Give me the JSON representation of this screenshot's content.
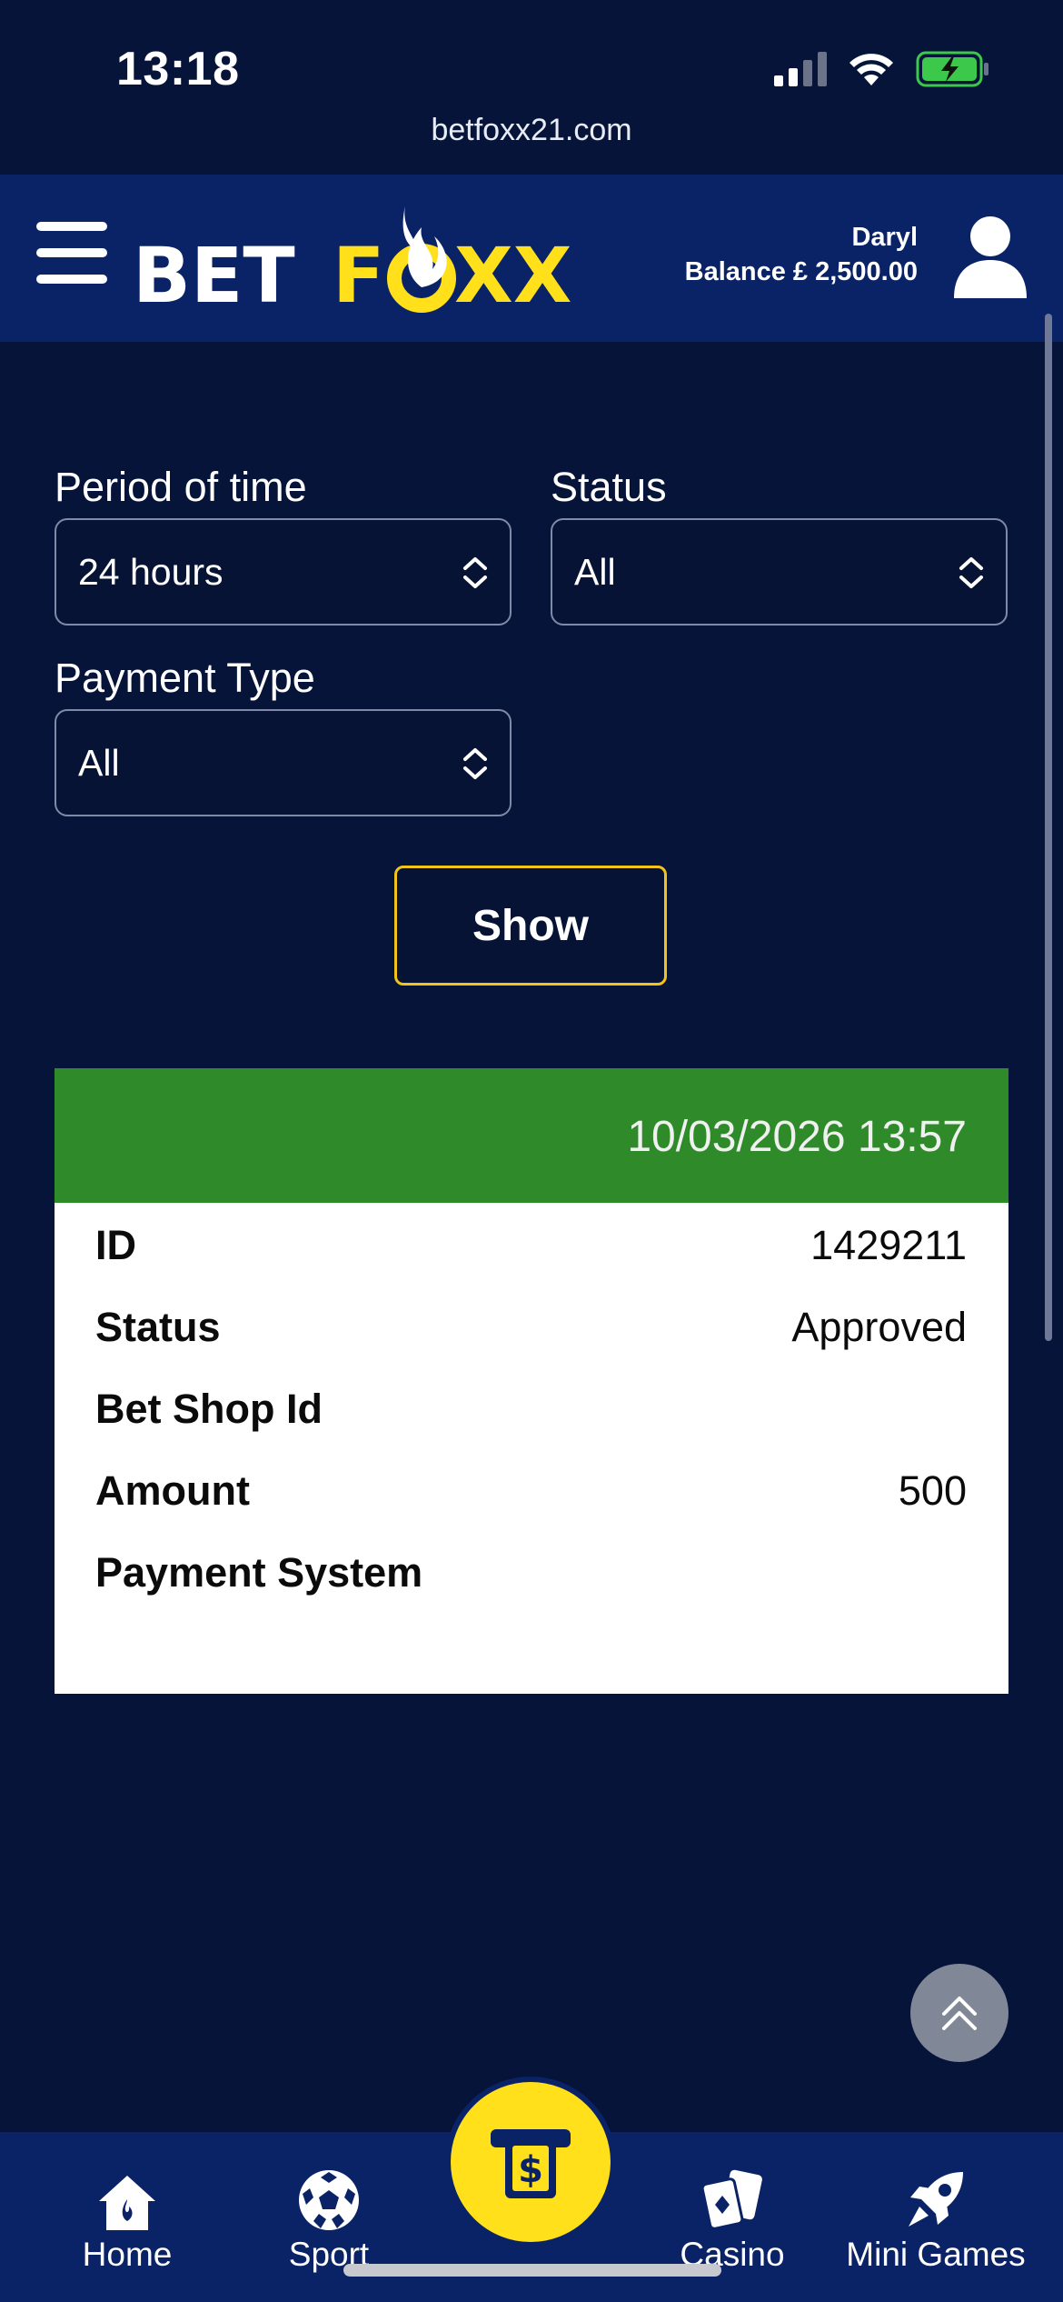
{
  "status_bar": {
    "time": "13:18"
  },
  "browser": {
    "url": "betfoxx21.com"
  },
  "header": {
    "logo_text_a": "BET",
    "logo_text_b": "F",
    "logo_text_c": "XX",
    "user_name": "Daryl",
    "balance": "Balance £ 2,500.00"
  },
  "filters": {
    "period_label": "Period of time",
    "period_value": "24 hours",
    "status_label": "Status",
    "status_value": "All",
    "payment_type_label": "Payment Type",
    "payment_type_value": "All",
    "show_label": "Show"
  },
  "transaction": {
    "datetime": "10/03/2026 13:57",
    "rows": [
      {
        "key": "ID",
        "value": "1429211"
      },
      {
        "key": "Status",
        "value": "Approved"
      },
      {
        "key": "Bet Shop Id",
        "value": ""
      },
      {
        "key": "Amount",
        "value": "500"
      },
      {
        "key": "Payment System",
        "value": ""
      }
    ]
  },
  "bottom_nav": {
    "items": [
      {
        "label": "Home",
        "icon": "home-icon"
      },
      {
        "label": "Sport",
        "icon": "soccer-ball-icon"
      },
      {
        "label": "Casino",
        "icon": "playing-cards-icon"
      },
      {
        "label": "Mini Games",
        "icon": "rocket-icon"
      }
    ],
    "center_icon": "atm-cash-icon"
  },
  "colors": {
    "background": "#07143a",
    "header": "#0a2266",
    "accent_yellow": "#ffe01b",
    "card_header_green": "#2f8a2a"
  }
}
